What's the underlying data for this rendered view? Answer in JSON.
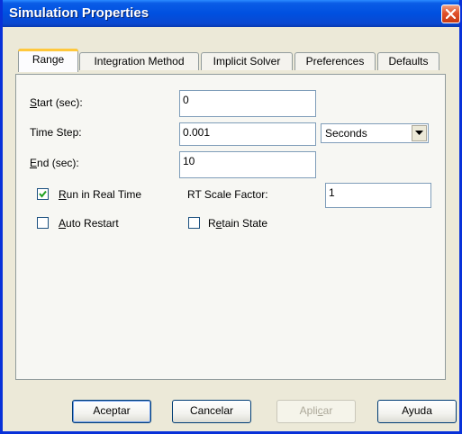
{
  "window": {
    "title": "Simulation Properties",
    "close_icon": "close-icon"
  },
  "tabs": [
    {
      "label": "Range",
      "active": true
    },
    {
      "label": "Integration Method",
      "active": false
    },
    {
      "label": "Implicit Solver",
      "active": false
    },
    {
      "label": "Preferences",
      "active": false
    },
    {
      "label": "Defaults",
      "active": false
    }
  ],
  "range": {
    "start_label_u": "S",
    "start_label_rest": "tart (sec):",
    "start_value": "0",
    "timestep_label": "Time Step:",
    "timestep_value": "0.001",
    "units_selected": "Seconds",
    "end_label_u": "E",
    "end_label_rest": "nd (sec):",
    "end_value": "10",
    "realtime_u": "R",
    "realtime_rest": "un in Real Time",
    "realtime_checked": true,
    "rt_scale_label": "RT Scale Factor:",
    "rt_scale_value": "1",
    "autorestart_u": "A",
    "autorestart_rest": "uto Restart",
    "autorestart_checked": false,
    "retain_pre": "R",
    "retain_u": "e",
    "retain_rest": "tain State",
    "retain_checked": false
  },
  "buttons": {
    "ok": "Aceptar",
    "cancel": "Cancelar",
    "apply_pre": "Apli",
    "apply_u": "c",
    "apply_rest": "ar",
    "help": "Ayuda"
  }
}
